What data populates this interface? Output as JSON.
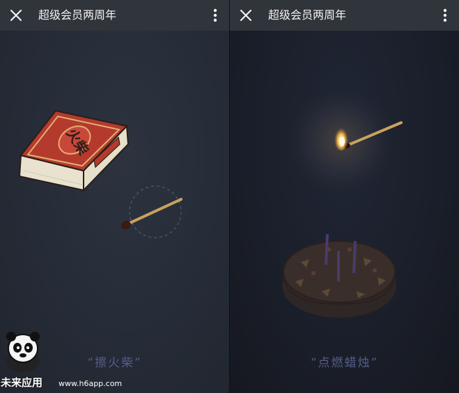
{
  "left_panel": {
    "title": "超级会员两周年",
    "caption": "“擦火柴”",
    "matchbox_label": "火柴"
  },
  "right_panel": {
    "title": "超级会员两周年",
    "caption": "“点燃蜡烛”"
  },
  "watermark": {
    "brand": "未来应用",
    "url": "www.h6app.com"
  },
  "icons": {
    "close": "close-icon",
    "more": "more-vertical-icon"
  },
  "colors": {
    "topbar": "#30343b",
    "caption": "#555d8a",
    "matchbox_red": "#b43a2e"
  }
}
